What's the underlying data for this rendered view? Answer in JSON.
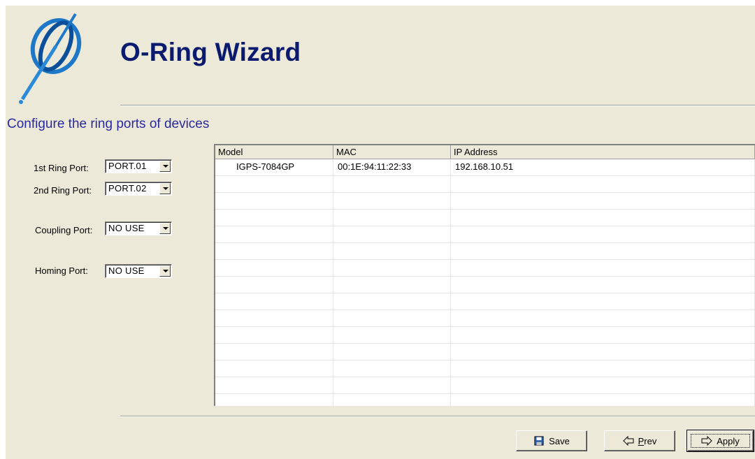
{
  "header": {
    "title": "O-Ring Wizard",
    "subtitle": "Configure the ring ports of devices"
  },
  "ports": {
    "first_ring": {
      "label": "1st Ring Port:",
      "value": "PORT.01"
    },
    "second_ring": {
      "label": "2nd Ring Port:",
      "value": "PORT.02"
    },
    "coupling": {
      "label": "Coupling Port:",
      "value": "NO USE"
    },
    "homing": {
      "label": "Homing Port:",
      "value": "NO USE"
    }
  },
  "table": {
    "columns": [
      "Model",
      "MAC",
      "IP Address"
    ],
    "rows": [
      {
        "model": "IGPS-7084GP",
        "mac": "00:1E:94:11:22:33",
        "ip": "192.168.10.51"
      }
    ]
  },
  "buttons": {
    "save": {
      "label": "Save",
      "icon": "floppy-disk-icon"
    },
    "prev": {
      "label": "Prev",
      "icon": "arrow-left-icon"
    },
    "apply": {
      "label": "Apply",
      "icon": "arrow-right-icon"
    }
  }
}
